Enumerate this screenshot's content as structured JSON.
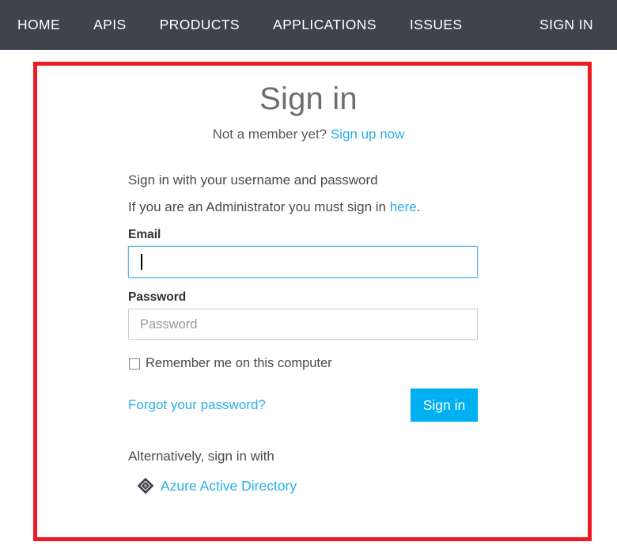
{
  "nav": {
    "left_items": [
      {
        "label": "HOME",
        "name": "nav-item-home"
      },
      {
        "label": "APIS",
        "name": "nav-item-apis"
      },
      {
        "label": "PRODUCTS",
        "name": "nav-item-products"
      },
      {
        "label": "APPLICATIONS",
        "name": "nav-item-applications"
      },
      {
        "label": "ISSUES",
        "name": "nav-item-issues"
      }
    ],
    "sign_in_label": "SIGN IN",
    "background": "#3e444d",
    "text_color": "#ffffff"
  },
  "annotation": {
    "highlight_color": "#ed1c24"
  },
  "card": {
    "title": "Sign in",
    "member_prompt": "Not a member yet? ",
    "signup_link": "Sign up now",
    "intro_1": "Sign in with your username and password",
    "intro_2_before": "If you are an Administrator you must sign in ",
    "intro_2_link": "here",
    "intro_2_after": ".",
    "email": {
      "label": "Email",
      "value": "",
      "placeholder": ""
    },
    "password": {
      "label": "Password",
      "value": "",
      "placeholder": "Password"
    },
    "remember_label": "Remember me on this computer",
    "remember_checked": false,
    "forgot_link": "Forgot your password?",
    "signin_button": "Sign in",
    "alternative_text": "Alternatively, sign in with",
    "aad_label": "Azure Active Directory",
    "aad_icon": "azure-active-directory-icon",
    "link_color": "#2aaee6",
    "button_color": "#00b0f0"
  }
}
